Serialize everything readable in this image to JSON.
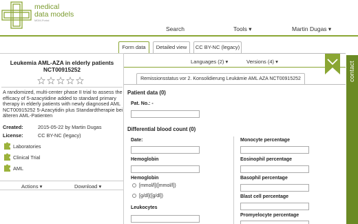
{
  "header": {
    "brand_line1": "medical",
    "brand_line2": "data models",
    "brand_sub": "MDM-Portal",
    "nav_search": "Search",
    "nav_tools": "Tools ▾",
    "nav_user": "Martin Dugas ▾",
    "accent_color": "#8aa633"
  },
  "tabs": [
    {
      "label": "Form data",
      "active": true
    },
    {
      "label": "Detailed view",
      "active": false
    },
    {
      "label": "CC BY-NC (legacy)",
      "active": false
    }
  ],
  "left": {
    "title_line1": "Leukemia AML-AZA in elderly patients",
    "title_line2": "NCT00915252",
    "rating_stars": 0,
    "rating_max": 5,
    "description": "A randomized, multi-center phase II trial to assess the efficacy of 5-azacytidine added to standard primary therapy in elderly patients with newly diagnosed AML NCT00915252 5-Azacytidin plus Standardtherapie bei älteren AML-Patienten",
    "created_label": "Created:",
    "created_value": "2015-05-22 by Martin Dugas",
    "license_label": "License:",
    "license_value": "CC BY-NC (legacy)",
    "keywords": [
      "Laboratories",
      "Clinical Trial",
      "AML"
    ],
    "actions_label": "Actions ▾",
    "download_label": "Download ▾"
  },
  "content": {
    "languages_label": "Languages (2) ▾",
    "versions_label": "Versions (4) ▾",
    "itemgroup_tab": "Remissionsstatus vor 2. Konsolidierung Leukämie AML AZA NCT00915252",
    "patient_section": "Patient data (0)",
    "pat_no_label": "Pat. No.: -",
    "dbc_section": "Differential blood count (0)",
    "left_fields": {
      "date": "Date:",
      "hemoglobin1": "Hemoglobin",
      "hemoglobin2": "Hemoglobin",
      "radio1": "[mmol/l]([mmol/l])",
      "radio2": "[g/dl]([g/dl])",
      "leukocytes": "Leukocytes"
    },
    "right_fields": {
      "monocyte": "Monocyte percentage",
      "eosinophil": "Eosinophil percentage",
      "basophil": "Basophil percentage",
      "blast": "Blast cell percentage",
      "promyelocyte": "Promyelocyte percentage"
    }
  },
  "contact_label": "contact"
}
